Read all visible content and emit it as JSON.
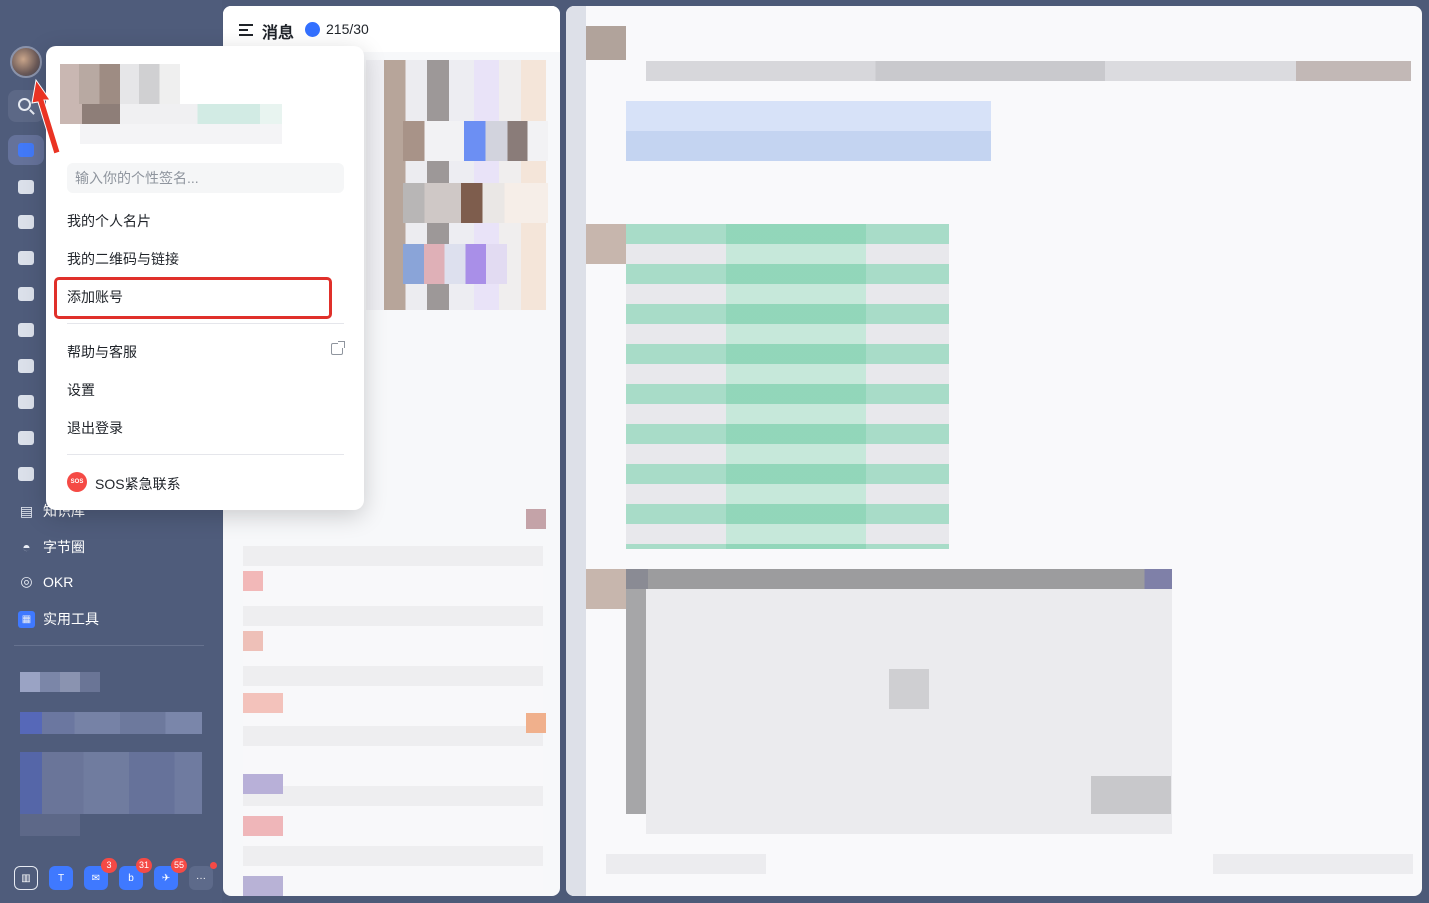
{
  "window": {
    "traffic_lights": [
      "close",
      "minimize",
      "zoom"
    ]
  },
  "sidebar": {
    "items": [
      {
        "label": "知识库",
        "icon": "book-icon"
      },
      {
        "label": "字节圈",
        "icon": "circle-feed-icon"
      },
      {
        "label": "OKR",
        "icon": "target-icon"
      },
      {
        "label": "实用工具",
        "icon": "tools-icon"
      }
    ],
    "dock": [
      {
        "icon": "chart-icon",
        "glyph": "▥"
      },
      {
        "icon": "app-t-icon",
        "glyph": "T"
      },
      {
        "icon": "app-icon",
        "glyph": "✉",
        "badge": "3"
      },
      {
        "icon": "app-icon",
        "glyph": "b",
        "badge": "31"
      },
      {
        "icon": "app-icon",
        "glyph": "✈",
        "badge": "55"
      },
      {
        "icon": "more-icon",
        "glyph": "···"
      }
    ]
  },
  "messages_panel": {
    "title": "消息",
    "stat": "215/30"
  },
  "profile_menu": {
    "signature_placeholder": "输入你的个性签名...",
    "items": {
      "business_card": "我的个人名片",
      "qr_link": "我的二维码与链接",
      "add_account": "添加账号",
      "help": "帮助与客服",
      "settings": "设置",
      "logout": "退出登录"
    },
    "sos": {
      "icon_text": "SOS",
      "label": "SOS紧急联系"
    }
  },
  "colors": {
    "accent": "#3370ff",
    "highlight": "#e0302a",
    "sidebar": "#4f5c7b"
  }
}
